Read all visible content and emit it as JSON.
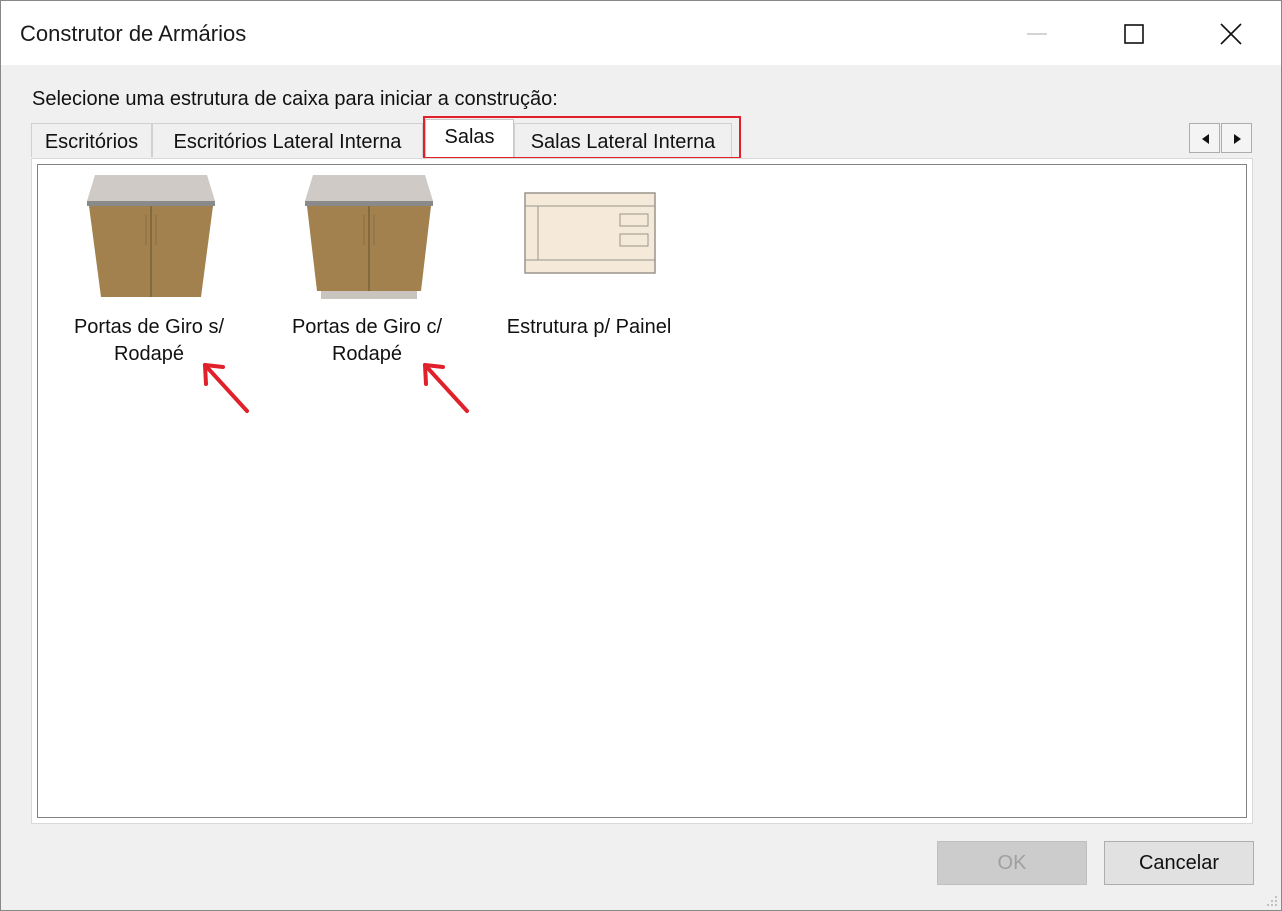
{
  "window": {
    "title": "Construtor de Armários"
  },
  "instruction": "Selecione uma estrutura de caixa para iniciar a construção:",
  "tabs": [
    {
      "label": "Escritórios",
      "active": false
    },
    {
      "label": "Escritórios Lateral Interna",
      "active": false
    },
    {
      "label": "Salas",
      "active": true
    },
    {
      "label": "Salas Lateral Interna",
      "active": false
    }
  ],
  "items": [
    {
      "line1": "Portas de Giro s/",
      "line2": "Rodapé",
      "icon": "cabinet-two-doors-icon"
    },
    {
      "line1": "Portas de Giro c/",
      "line2": "Rodapé",
      "icon": "cabinet-two-doors-with-plinth-icon"
    },
    {
      "line1": "Estrutura p/ Painel",
      "line2": "",
      "icon": "panel-structure-icon"
    }
  ],
  "buttons": {
    "ok": "OK",
    "cancel": "Cancelar"
  },
  "colors": {
    "highlight": "#e0202a",
    "wood": "#a3814f",
    "top": "#cfcac5",
    "panel_fill": "#f5eada"
  }
}
